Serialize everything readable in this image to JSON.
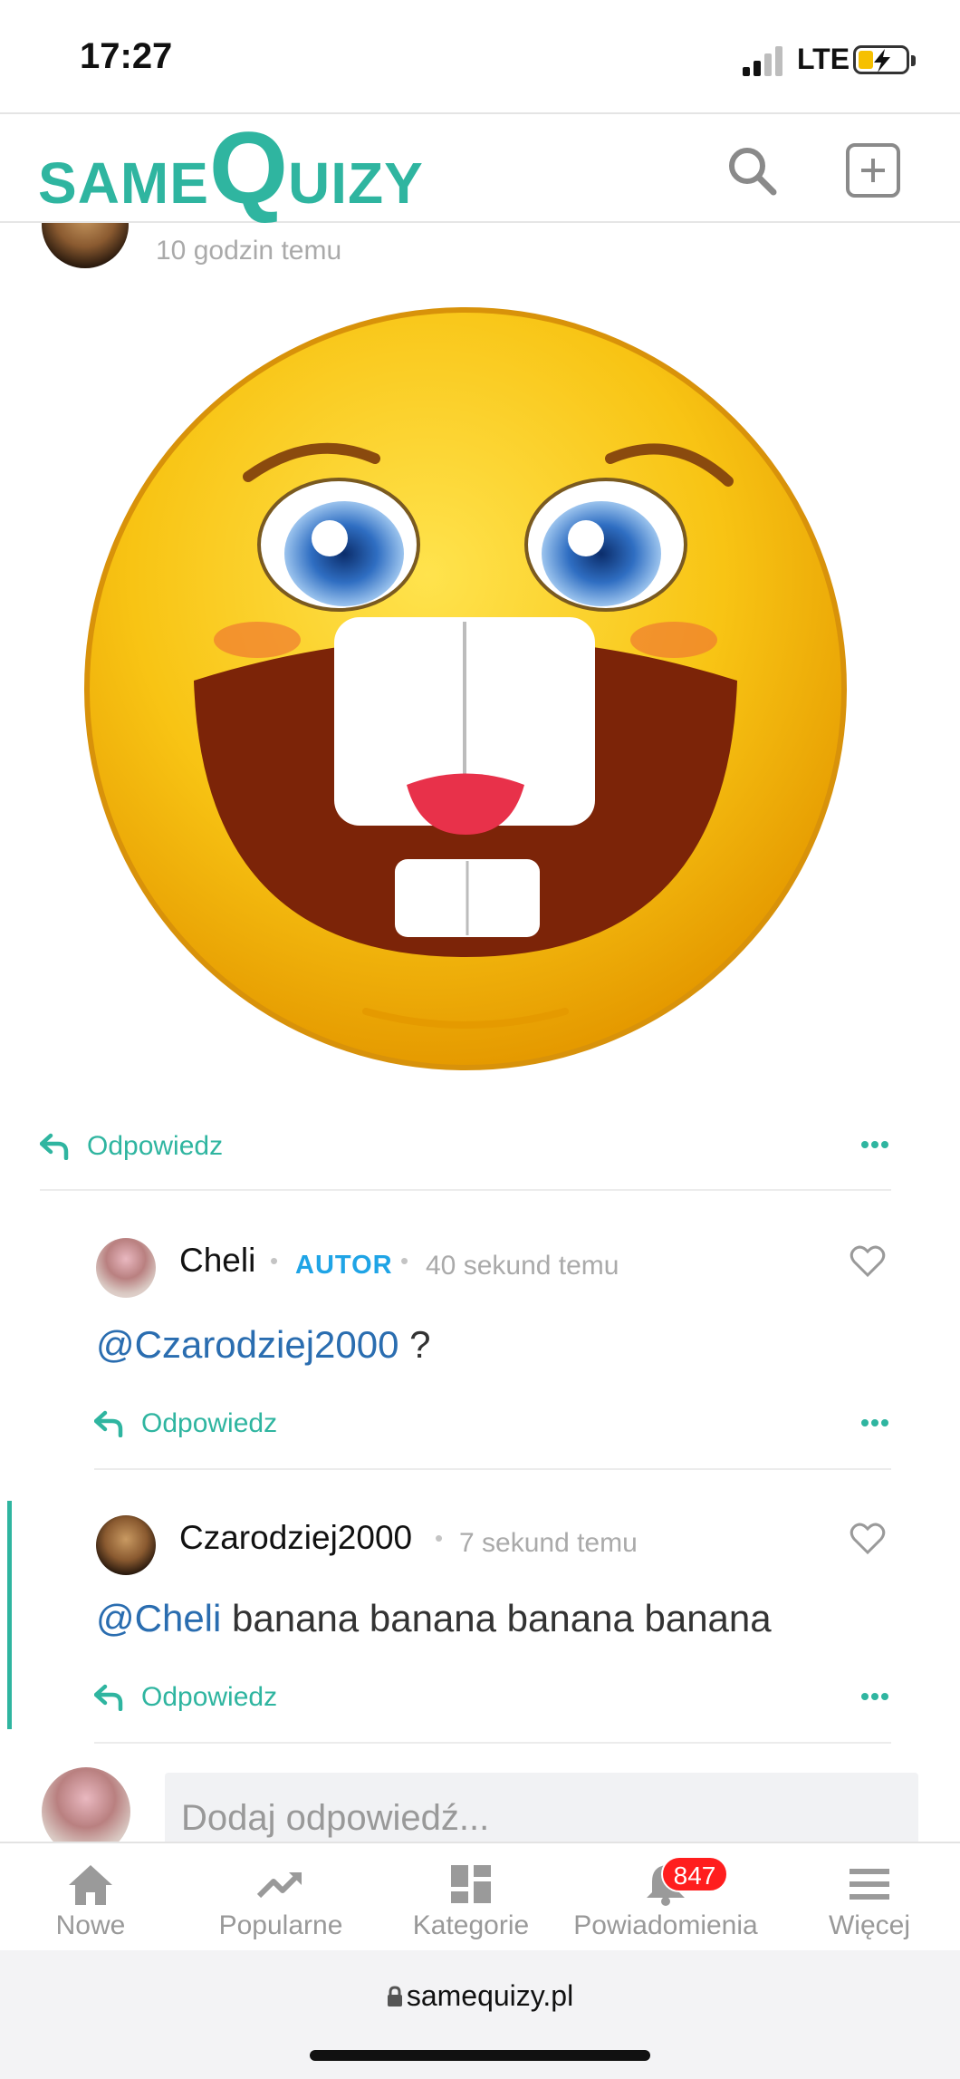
{
  "status_bar": {
    "time": "17:27",
    "network": "LTE"
  },
  "header": {
    "logo_small_1": "SAME",
    "logo_big": "Q",
    "logo_small_2": "UIZY"
  },
  "post": {
    "timestamp": "10 godzin temu",
    "reply_label": "Odpowiedz"
  },
  "comments": [
    {
      "author": "Cheli",
      "badge": "AUTOR",
      "time": "40 sekund temu",
      "mention": "@Czarodziej2000",
      "text": " ?",
      "reply_label": "Odpowiedz"
    },
    {
      "author": "Czarodziej2000",
      "time": "7 sekund temu",
      "mention": "@Cheli",
      "text": " banana banana banana banana",
      "reply_label": "Odpowiedz"
    }
  ],
  "reply_box": {
    "placeholder": "Dodaj odpowiedź..."
  },
  "bottom_nav": {
    "items": [
      {
        "label": "Nowe",
        "icon": "home-icon"
      },
      {
        "label": "Popularne",
        "icon": "trending-icon"
      },
      {
        "label": "Kategorie",
        "icon": "grid-icon"
      },
      {
        "label": "Powiadomienia",
        "icon": "bell-icon"
      },
      {
        "label": "Więcej",
        "icon": "menu-icon"
      }
    ],
    "notifications_count": "847"
  },
  "browser": {
    "url": "samequizy.pl"
  },
  "colors": {
    "accent": "#2fb5a0",
    "autor": "#1fa4e6",
    "mention": "#2a6db0",
    "badge": "#ff1e1e"
  }
}
